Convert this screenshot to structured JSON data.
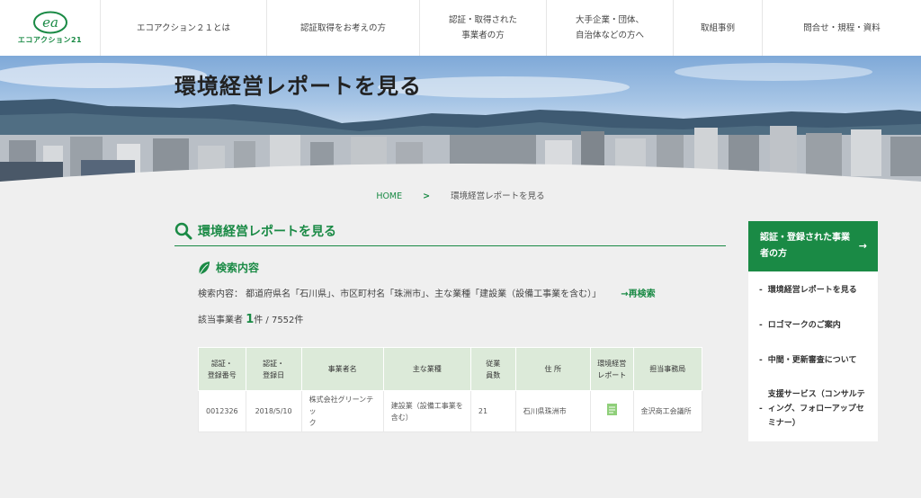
{
  "logo": {
    "text": "エコアクション21"
  },
  "nav": [
    "エコアクション２１とは",
    "認証取得をお考えの方",
    "認証・取得された\n事業者の方",
    "大手企業・団体、\n自治体などの方へ",
    "取組事例",
    "問合せ・規程・資料"
  ],
  "hero": {
    "title": "環境経営レポートを見る"
  },
  "breadcrumb": {
    "home": "HOME",
    "separator": ">",
    "current": "環境経営レポートを見る"
  },
  "main": {
    "title": "環境経営レポートを見る",
    "subtitle": "検索内容",
    "condition": "検索内容： 都道府県名「石川県」、市区町村名「珠洲市」、主な業種「建設業（設備工事業を含む）」",
    "research": "→再検索",
    "count_label": "該当事業者",
    "count_num": "1",
    "count_suffix": "件 / 7552件"
  },
  "table": {
    "headers": [
      "認証・\n登録番号",
      "認証・\n登録日",
      "事業者名",
      "主な業種",
      "従業\n員数",
      "住 所",
      "環境経営\nレポート",
      "担当事務局"
    ],
    "row": {
      "id": "0012326",
      "date": "2018/5/10",
      "name": "株式会社グリーンテッ\nク",
      "industry": "建設業（設備工事業を\n含む）",
      "employees": "21",
      "address": "石川県珠洲市",
      "office": "金沢商工会議所"
    }
  },
  "sidebar": {
    "head": "認証・登録された事業者の方",
    "head_arrow": "→",
    "items": [
      "環境経営レポートを見る",
      "ロゴマークのご案内",
      "中間・更新審査について",
      "支援サービス（コンサルティング、フォローアップセミナー）"
    ]
  },
  "colors": {
    "accent": "#1a8a45",
    "table_header": "#dcead9"
  }
}
